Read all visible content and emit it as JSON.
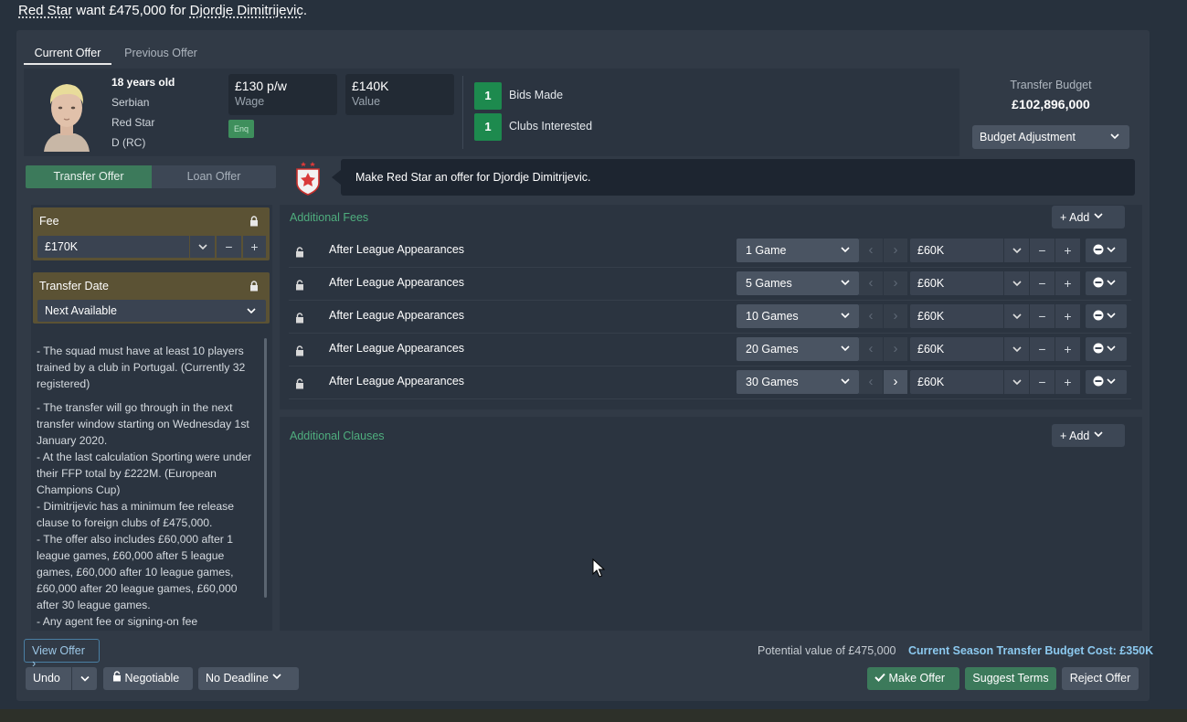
{
  "header": {
    "club": "Red Star",
    "middle": " want £475,000 for ",
    "player": "Djordje Dimitrijevic",
    "end": "."
  },
  "tabs": {
    "current": "Current Offer",
    "previous": "Previous Offer"
  },
  "player": {
    "age": "18 years old",
    "nationality": "Serbian",
    "club": "Red Star",
    "position": "D (RC)",
    "wage_value": "£130 p/w",
    "wage_label": "Wage",
    "value_value": "£140K",
    "value_label": "Value",
    "enquire": "Enq"
  },
  "stats": {
    "bids_count": "1",
    "bids_label": "Bids Made",
    "clubs_count": "1",
    "clubs_label": "Clubs Interested"
  },
  "budget": {
    "label": "Transfer Budget",
    "value": "£102,896,000",
    "adjust": "Budget Adjustment"
  },
  "offer_type": {
    "transfer": "Transfer Offer",
    "loan": "Loan Offer"
  },
  "message": "Make Red Star an offer for Djordje Dimitrijevic.",
  "fee": {
    "label": "Fee",
    "value": "£170K"
  },
  "transfer_date": {
    "label": "Transfer Date",
    "value": "Next Available"
  },
  "notes": [
    "- The squad must have at least 10 players trained by a club in Portugal. (Currently 32 registered)",
    "- The transfer will go through in the next transfer window starting on Wednesday 1st January 2020.",
    "- At the last calculation Sporting were under their FFP total by £222M. (European Champions Cup)",
    "- Dimitrijevic has a minimum fee release clause to foreign clubs of £475,000.",
    "-  The offer also includes £60,000 after 1 league games, £60,000 after 5 league games, £60,000 after 10 league games, £60,000 after 20 league games, £60,000 after 30 league games.",
    "- Any agent fee or signing-on fee"
  ],
  "additional_fees": {
    "title": "Additional Fees",
    "add_label": "Add",
    "rows": [
      {
        "label": "After League Appearances",
        "games": "1 Game",
        "amount": "£60K"
      },
      {
        "label": "After League Appearances",
        "games": "5 Games",
        "amount": "£60K"
      },
      {
        "label": "After League Appearances",
        "games": "10 Games",
        "amount": "£60K"
      },
      {
        "label": "After League Appearances",
        "games": "20 Games",
        "amount": "£60K"
      },
      {
        "label": "After League Appearances",
        "games": "30 Games",
        "amount": "£60K"
      }
    ]
  },
  "additional_clauses": {
    "title": "Additional Clauses",
    "add_label": "Add"
  },
  "footer": {
    "view_offer": "View Offer",
    "potential": "Potential value of £475,000",
    "budget_cost": "Current Season Transfer Budget Cost: £350K",
    "undo": "Undo",
    "negotiable": "Negotiable",
    "deadline": "No Deadline",
    "make_offer": "Make Offer",
    "suggest_terms": "Suggest Terms",
    "reject_offer": "Reject Offer"
  },
  "colors": {
    "accent_green": "#3c7a5b",
    "section_title": "#4fae7e",
    "link_blue": "#8cc9ef",
    "panel": "#313a46"
  }
}
